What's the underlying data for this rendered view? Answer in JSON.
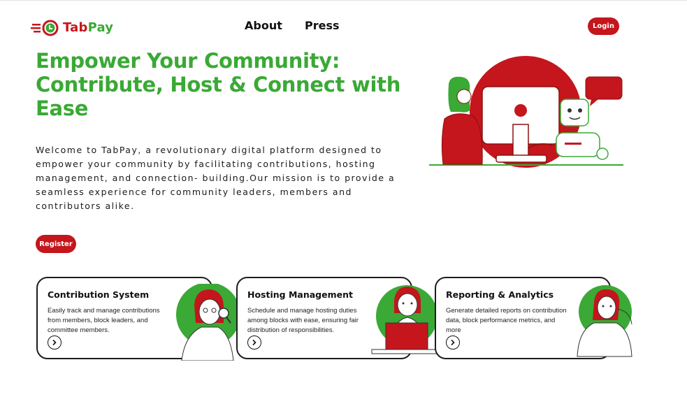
{
  "brand": {
    "name_part1": "Tab",
    "name_part2": "Pay",
    "colors": {
      "red": "#c4161c",
      "green": "#3aa935",
      "dark": "#1d1d1d"
    }
  },
  "nav": {
    "items": [
      {
        "label": "About"
      },
      {
        "label": "Press"
      }
    ],
    "login_label": "Login"
  },
  "hero": {
    "title": "Empower Your Community: Contribute, Host & Connect with Ease",
    "body": "Welcome to TabPay, a revolutionary digital platform designed to empower your community by facilitating contributions, hosting management, and connection- building.Our mission is to provide a seamless experience for community leaders, members and contributors alike.",
    "register_label": "Register",
    "illustration": "person-at-computer-with-robot-illustration"
  },
  "cards": [
    {
      "title": "Contribution System",
      "description": "Easily track and manage contributions from members, block leaders, and committee members.",
      "arrow_icon": "arrow-right-circle-icon",
      "illustration": "woman-with-magnifier-illustration"
    },
    {
      "title": "Hosting Management",
      "description": "Schedule and manage hosting duties among blocks with ease, ensuring fair distribution of responsibilities.",
      "arrow_icon": "arrow-right-circle-icon",
      "illustration": "woman-at-laptop-illustration"
    },
    {
      "title": "Reporting & Analytics",
      "description": "Generate detailed reports on contribution data, block performance metrics, and more",
      "arrow_icon": "arrow-right-circle-icon",
      "illustration": "woman-thinking-illustration"
    }
  ]
}
